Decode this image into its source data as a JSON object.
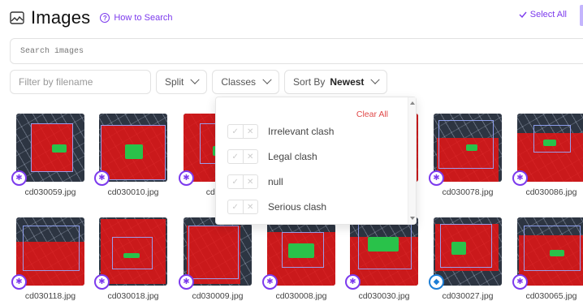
{
  "header": {
    "title": "Images",
    "help_label": "How to Search",
    "select_all_label": "Select All"
  },
  "search": {
    "placeholder": "Search images"
  },
  "filters": {
    "filename_placeholder": "Filter by filename",
    "split_label": "Split",
    "classes_label": "Classes",
    "sort_prefix": "Sort By",
    "sort_value": "Newest"
  },
  "classes_popup": {
    "clear_all_label": "Clear All",
    "options": [
      "Irrelevant clash",
      "Legal clash",
      "null",
      "Serious clash"
    ]
  },
  "images": [
    {
      "name": "cd030059.jpg",
      "badge": "person-icon"
    },
    {
      "name": "cd030010.jpg",
      "badge": "person-icon"
    },
    {
      "name": "cd030",
      "badge": "person-icon"
    },
    {
      "name": "",
      "badge": ""
    },
    {
      "name": "",
      "badge": ""
    },
    {
      "name": "cd030078.jpg",
      "badge": "person-icon"
    },
    {
      "name": "cd030086.jpg",
      "badge": "person-icon"
    },
    {
      "name": "cd030118.jpg",
      "badge": "person-icon"
    },
    {
      "name": "cd030018.jpg",
      "badge": "person-icon"
    },
    {
      "name": "cd030009.jpg",
      "badge": "person-icon"
    },
    {
      "name": "cd030008.jpg",
      "badge": "person-icon"
    },
    {
      "name": "cd030030.jpg",
      "badge": "person-icon"
    },
    {
      "name": "cd030027.jpg",
      "badge": "shield-icon"
    },
    {
      "name": "cd030065.jpg",
      "badge": "person-icon"
    }
  ],
  "colors": {
    "accent": "#7c3aed",
    "clear": "#e04848",
    "badge_blue": "#1d7ed6"
  }
}
